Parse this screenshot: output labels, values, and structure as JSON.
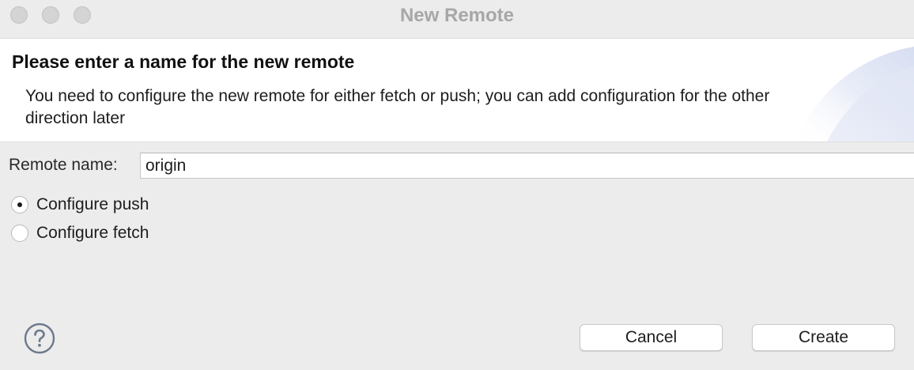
{
  "window": {
    "title": "New Remote"
  },
  "banner": {
    "heading": "Please enter a name for the new remote",
    "description": "You need to configure the new remote for either fetch or push; you can add configuration for the other direction later"
  },
  "form": {
    "remote_name_label": "Remote name:",
    "remote_name_value": "origin"
  },
  "options": [
    {
      "label": "Configure push",
      "checked": true
    },
    {
      "label": "Configure fetch",
      "checked": false
    }
  ],
  "buttons": {
    "cancel": "Cancel",
    "create": "Create"
  },
  "icons": {
    "help": "help-icon"
  },
  "colors": {
    "window_bg": "#ececec",
    "banner_bg": "#ffffff",
    "title_text": "#a7a7a7",
    "banner_accent": "#e6ebf7"
  }
}
